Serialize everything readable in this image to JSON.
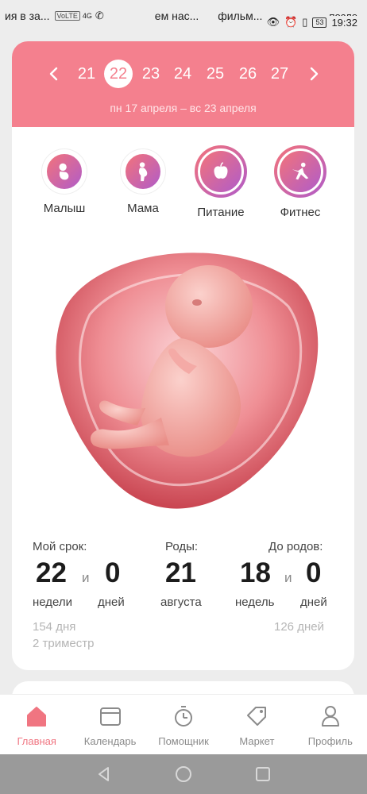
{
  "status_bar": {
    "notifications": [
      "ия в за...",
      "ем нас...",
      "фильм...",
      "после"
    ],
    "network": "VoLTE",
    "signal": "4G",
    "battery": "53",
    "time": "19:32"
  },
  "week_nav": {
    "weeks": [
      "21",
      "22",
      "23",
      "24",
      "25",
      "26",
      "27"
    ],
    "active_week": "22",
    "date_range": "пн 17 апреля – вс 23 апреля"
  },
  "categories": [
    {
      "label": "Малыш",
      "icon": "baby-icon"
    },
    {
      "label": "Мама",
      "icon": "pregnant-woman-icon"
    },
    {
      "label": "Питание",
      "icon": "apple-icon"
    },
    {
      "label": "Фитнес",
      "icon": "fitness-icon"
    }
  ],
  "stats": {
    "term_label": "Мой срок:",
    "term_weeks": "22",
    "and1": "и",
    "term_days": "0",
    "weeks_unit": "недели",
    "days_unit": "дней",
    "due_label": "Роды:",
    "due_day": "21",
    "due_month": "августа",
    "remaining_label": "До родов:",
    "remaining_weeks": "18",
    "and2": "и",
    "remaining_days": "0",
    "remaining_weeks_unit": "недель",
    "remaining_days_unit": "дней",
    "days_passed": "154 дня",
    "trimester": "2 триместр",
    "days_left": "126 дней"
  },
  "bottom_nav": [
    {
      "label": "Главная",
      "icon": "home-icon",
      "active": true
    },
    {
      "label": "Календарь",
      "icon": "calendar-icon",
      "active": false
    },
    {
      "label": "Помощник",
      "icon": "stopwatch-icon",
      "active": false
    },
    {
      "label": "Маркет",
      "icon": "tag-icon",
      "active": false
    },
    {
      "label": "Профиль",
      "icon": "profile-icon",
      "active": false
    }
  ],
  "colors": {
    "accent": "#f4808e",
    "active_nav": "#f07581",
    "gradient_start": "#f3737a",
    "gradient_end": "#b05cc9"
  }
}
